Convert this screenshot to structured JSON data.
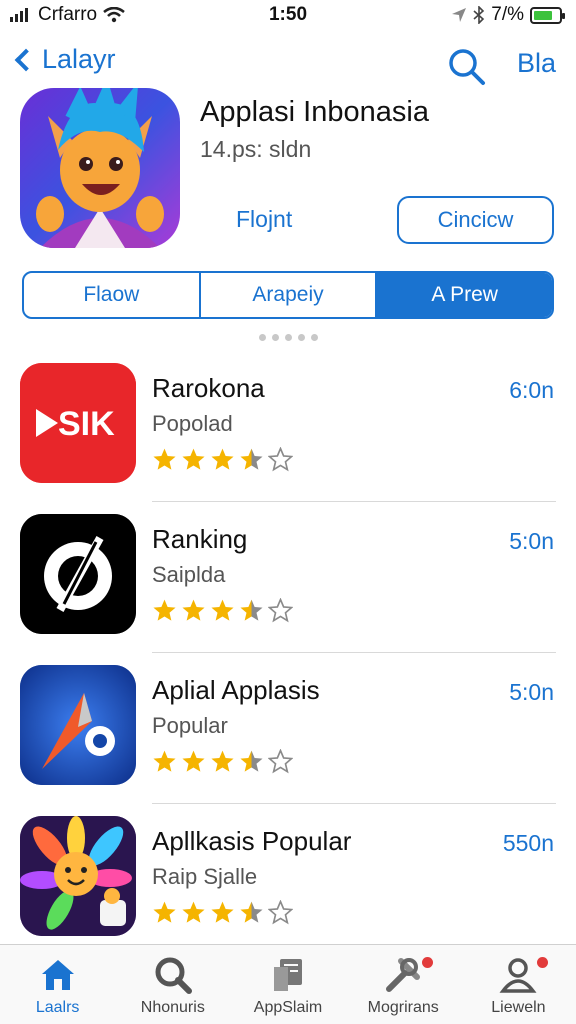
{
  "status_bar": {
    "carrier": "Crfarro",
    "time": "1:50",
    "battery_text": "7/%",
    "battery_level": 0.77
  },
  "nav": {
    "back_label": "Lalayr",
    "action_label": "Bla",
    "search_icon": "search-icon"
  },
  "header": {
    "title": "Applasi Inbonasia",
    "subtitle": "14.ps: sldn",
    "link_label": "Flojnt",
    "button_label": "Cincicw"
  },
  "segments": [
    {
      "label": "Flaow",
      "active": false
    },
    {
      "label": "Arapeiy",
      "active": false
    },
    {
      "label": "A Prew",
      "active": true
    }
  ],
  "apps": [
    {
      "title": "Rarokona",
      "subtitle": "Popolad",
      "price": "6:0n",
      "rating": 3.5,
      "icon": "video-play-icon",
      "icon_text": "SIK",
      "color": "#e8262a"
    },
    {
      "title": "Ranking",
      "subtitle": "Saiplda",
      "price": "5:0n",
      "rating": 3.5,
      "icon": "circle-slash-icon",
      "color": "#000000"
    },
    {
      "title": "Aplial Applasis",
      "subtitle": "Popular",
      "price": "5:0n",
      "rating": 3.5,
      "icon": "compass-icon",
      "color": "#1446a8"
    },
    {
      "title": "Apllkasis Popular",
      "subtitle": "Raip Sjalle",
      "price": "550n",
      "rating": 3.5,
      "icon": "flower-character-icon",
      "color": "#3a1c6e"
    }
  ],
  "tabs": [
    {
      "label": "Laalrs",
      "icon": "home-icon",
      "active": true,
      "badge": false
    },
    {
      "label": "Nhonuris",
      "icon": "search-icon",
      "active": false,
      "badge": false
    },
    {
      "label": "AppSlaim",
      "icon": "document-icon",
      "active": false,
      "badge": false
    },
    {
      "label": "Mogrirans",
      "icon": "tools-icon",
      "active": false,
      "badge": true
    },
    {
      "label": "Lieweln",
      "icon": "person-icon",
      "active": false,
      "badge": true
    }
  ]
}
